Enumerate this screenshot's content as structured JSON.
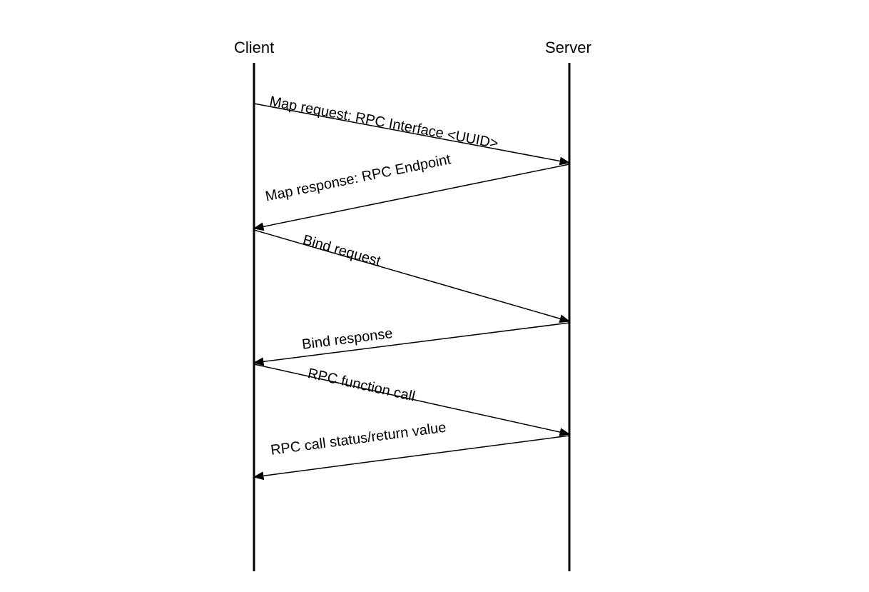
{
  "actors": {
    "client": "Client",
    "server": "Server"
  },
  "messages": [
    {
      "label": "Map request: RPC Interface <UUID>",
      "direction": "right"
    },
    {
      "label": "Map response: RPC Endpoint",
      "direction": "left"
    },
    {
      "label": "Bind request",
      "direction": "right"
    },
    {
      "label": "Bind response",
      "direction": "left"
    },
    {
      "label": "RPC function call",
      "direction": "right"
    },
    {
      "label": "RPC call status/return value",
      "direction": "left"
    }
  ]
}
